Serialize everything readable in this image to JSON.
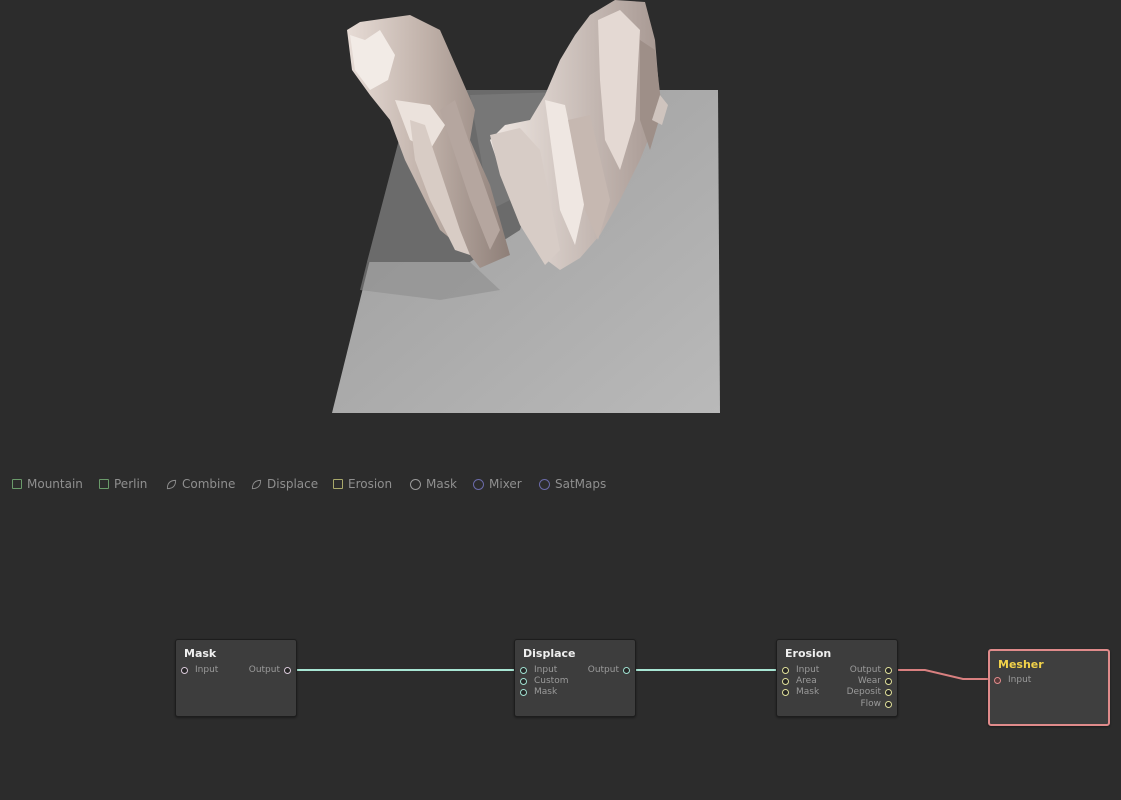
{
  "palette": {
    "items": [
      {
        "label": "Mountain",
        "icon": "square-icon",
        "color": "#6a9a6a"
      },
      {
        "label": "Perlin",
        "icon": "square-icon",
        "color": "#6a9a6a"
      },
      {
        "label": "Combine",
        "icon": "leaf-icon",
        "color": "#8c8c8c"
      },
      {
        "label": "Displace",
        "icon": "leaf-icon",
        "color": "#8c8c8c"
      },
      {
        "label": "Erosion",
        "icon": "square-icon",
        "color": "#a8a86a"
      },
      {
        "label": "Mask",
        "icon": "circle-icon",
        "color": "#9a9a9a"
      },
      {
        "label": "Mixer",
        "icon": "circle-icon",
        "color": "#6a6aa8"
      },
      {
        "label": "SatMaps",
        "icon": "circle-icon",
        "color": "#6a6aa8"
      }
    ]
  },
  "nodes": {
    "mask": {
      "title": "Mask",
      "inputs": [
        "Input"
      ],
      "outputs": [
        "Output"
      ],
      "port_color": "#d9c9d9"
    },
    "displace": {
      "title": "Displace",
      "inputs": [
        "Input",
        "Custom",
        "Mask"
      ],
      "outputs": [
        "Output"
      ],
      "port_color": "#9fe0d0"
    },
    "erosion": {
      "title": "Erosion",
      "inputs": [
        "Input",
        "Area",
        "Mask"
      ],
      "outputs": [
        "Output",
        "Wear",
        "Deposit",
        "Flow"
      ],
      "port_color": "#e0e09a"
    },
    "mesher": {
      "title": "Mesher",
      "inputs": [
        "Input"
      ],
      "outputs": [],
      "port_color": "#e08b8b"
    }
  },
  "colors": {
    "background": "#2c2c2c",
    "wire_teal": "#a8e6d4",
    "wire_red": "#d98080",
    "mesher_border": "#e08b8b",
    "mesher_title": "#f2d24a"
  }
}
